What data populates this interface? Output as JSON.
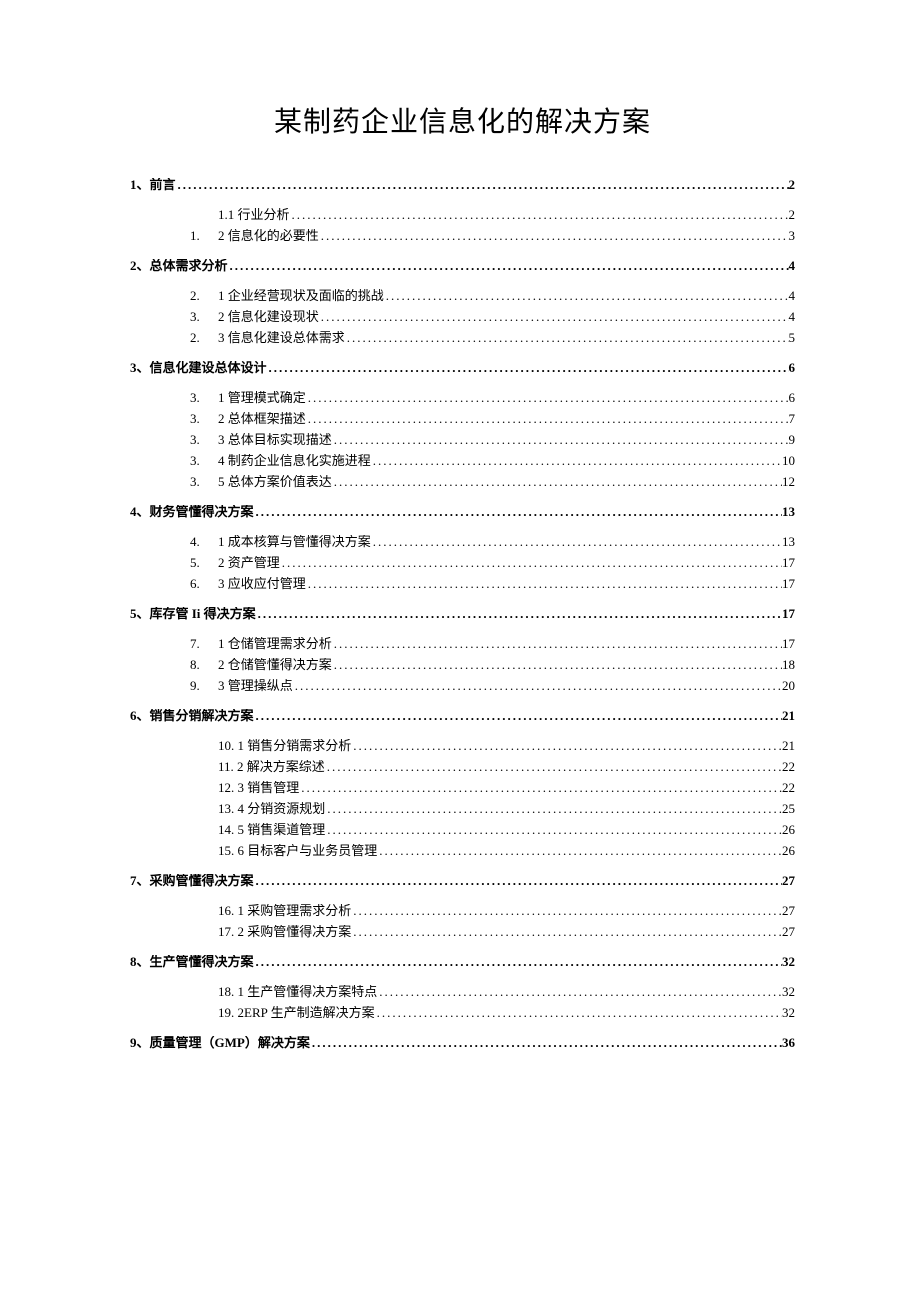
{
  "title": "某制药企业信息化的解决方案",
  "toc": [
    {
      "level": 1,
      "label": "1、前言",
      "page": "2"
    },
    {
      "level": 2,
      "num": "",
      "label": "1.1 行业分析",
      "page": "2"
    },
    {
      "level": 2,
      "num": "1.",
      "label": "2 信息化的必要性",
      "page": "3"
    },
    {
      "level": 1,
      "label": "2、总体需求分析",
      "page": "4"
    },
    {
      "level": 2,
      "num": "2.",
      "label": "1 企业经营现状及面临的挑战",
      "page": "4"
    },
    {
      "level": 2,
      "num": "3.",
      "label": "2 信息化建设现状",
      "page": "4"
    },
    {
      "level": 2,
      "num": "2.",
      "label": "3 信息化建设总体需求",
      "page": "5"
    },
    {
      "level": 1,
      "label": "3、信息化建设总体设计",
      "page": "6"
    },
    {
      "level": 2,
      "num": "3.",
      "label": "1 管理模式确定",
      "page": "6"
    },
    {
      "level": 2,
      "num": "3.",
      "label": "2 总体框架描述",
      "page": "7"
    },
    {
      "level": 2,
      "num": "3.",
      "label": "3 总体目标实现描述",
      "page": "9"
    },
    {
      "level": 2,
      "num": "3.",
      "label": "4 制药企业信息化实施进程",
      "page": "10"
    },
    {
      "level": 2,
      "num": "3.",
      "label": "5 总体方案价值表达",
      "page": "12"
    },
    {
      "level": 1,
      "label": "4、财务管懂得决方案",
      "page": "13"
    },
    {
      "level": 2,
      "num": "4.",
      "label": "1 成本核算与管懂得决方案",
      "page": "13"
    },
    {
      "level": 2,
      "num": "5.",
      "label": "2 资产管理",
      "page": "17"
    },
    {
      "level": 2,
      "num": "6.",
      "label": "3 应收应付管理",
      "page": "17"
    },
    {
      "level": 1,
      "label": "5、库存管 Ii 得决方案",
      "page": "17"
    },
    {
      "level": 2,
      "num": "7.",
      "label": "1 仓储管理需求分析",
      "page": "17"
    },
    {
      "level": 2,
      "num": "8.",
      "label": "2 仓储管懂得决方案",
      "page": "18"
    },
    {
      "level": 2,
      "num": "9.",
      "label": "3 管理操纵点",
      "page": "20"
    },
    {
      "level": 1,
      "label": "6、销售分销解决方案",
      "page": "21"
    },
    {
      "level": 2,
      "num": "",
      "label": "10. 1 销售分销需求分析",
      "page": "21"
    },
    {
      "level": 2,
      "num": "",
      "label": "11. 2 解决方案综述",
      "page": "22"
    },
    {
      "level": 2,
      "num": "",
      "label": "12. 3 销售管理",
      "page": "22"
    },
    {
      "level": 2,
      "num": "",
      "label": "13. 4 分销资源规划",
      "page": "25"
    },
    {
      "level": 2,
      "num": "",
      "label": "14. 5 销售渠道管理",
      "page": "26"
    },
    {
      "level": 2,
      "num": "",
      "label": "15. 6 目标客户与业务员管理",
      "page": "26"
    },
    {
      "level": 1,
      "label": "7、采购管懂得决方案",
      "page": "27"
    },
    {
      "level": 2,
      "num": "",
      "label": "16. 1 采购管理需求分析",
      "page": "27"
    },
    {
      "level": 2,
      "num": "",
      "label": "17. 2 采购管懂得决方案",
      "page": "27"
    },
    {
      "level": 1,
      "label": "8、生产管懂得决方案",
      "page": "32"
    },
    {
      "level": 2,
      "num": "",
      "label": "18. 1 生产管懂得决方案特点",
      "page": "32"
    },
    {
      "level": 2,
      "num": "",
      "label": "19. 2ERP 生产制造解决方案",
      "page": "32"
    },
    {
      "level": 1,
      "label": "9、质量管理（GMP）解决方案",
      "page": "36"
    }
  ]
}
